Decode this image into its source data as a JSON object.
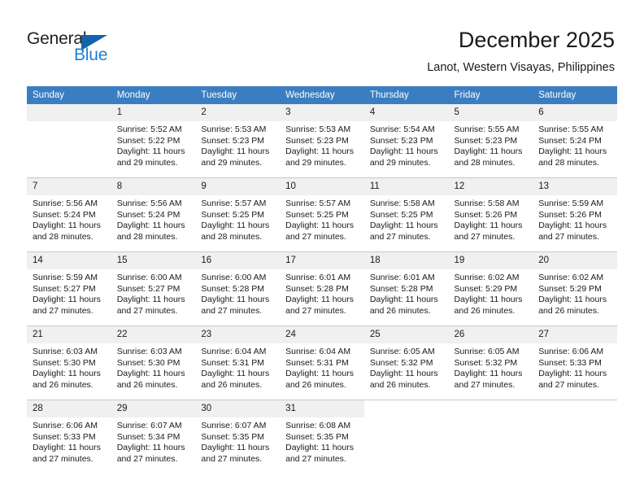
{
  "brand": {
    "name_top": "General",
    "name_bottom": "Blue",
    "accent_color": "#1c7fd4",
    "flag_color": "#1263ad",
    "logo_icon": "triangle-flag-icon"
  },
  "header": {
    "title": "December 2025",
    "subtitle": "Lanot, Western Visayas, Philippines"
  },
  "calendar": {
    "header_bg": "#3a7ec1",
    "daynum_bg": "#f0f0f0",
    "weekdays": [
      "Sunday",
      "Monday",
      "Tuesday",
      "Wednesday",
      "Thursday",
      "Friday",
      "Saturday"
    ],
    "weeks": [
      [
        {
          "day": "",
          "sunrise": "",
          "sunset": "",
          "daylight": "",
          "empty": true
        },
        {
          "day": "1",
          "sunrise": "Sunrise: 5:52 AM",
          "sunset": "Sunset: 5:22 PM",
          "daylight": "Daylight: 11 hours and 29 minutes."
        },
        {
          "day": "2",
          "sunrise": "Sunrise: 5:53 AM",
          "sunset": "Sunset: 5:23 PM",
          "daylight": "Daylight: 11 hours and 29 minutes."
        },
        {
          "day": "3",
          "sunrise": "Sunrise: 5:53 AM",
          "sunset": "Sunset: 5:23 PM",
          "daylight": "Daylight: 11 hours and 29 minutes."
        },
        {
          "day": "4",
          "sunrise": "Sunrise: 5:54 AM",
          "sunset": "Sunset: 5:23 PM",
          "daylight": "Daylight: 11 hours and 29 minutes."
        },
        {
          "day": "5",
          "sunrise": "Sunrise: 5:55 AM",
          "sunset": "Sunset: 5:23 PM",
          "daylight": "Daylight: 11 hours and 28 minutes."
        },
        {
          "day": "6",
          "sunrise": "Sunrise: 5:55 AM",
          "sunset": "Sunset: 5:24 PM",
          "daylight": "Daylight: 11 hours and 28 minutes."
        }
      ],
      [
        {
          "day": "7",
          "sunrise": "Sunrise: 5:56 AM",
          "sunset": "Sunset: 5:24 PM",
          "daylight": "Daylight: 11 hours and 28 minutes."
        },
        {
          "day": "8",
          "sunrise": "Sunrise: 5:56 AM",
          "sunset": "Sunset: 5:24 PM",
          "daylight": "Daylight: 11 hours and 28 minutes."
        },
        {
          "day": "9",
          "sunrise": "Sunrise: 5:57 AM",
          "sunset": "Sunset: 5:25 PM",
          "daylight": "Daylight: 11 hours and 28 minutes."
        },
        {
          "day": "10",
          "sunrise": "Sunrise: 5:57 AM",
          "sunset": "Sunset: 5:25 PM",
          "daylight": "Daylight: 11 hours and 27 minutes."
        },
        {
          "day": "11",
          "sunrise": "Sunrise: 5:58 AM",
          "sunset": "Sunset: 5:25 PM",
          "daylight": "Daylight: 11 hours and 27 minutes."
        },
        {
          "day": "12",
          "sunrise": "Sunrise: 5:58 AM",
          "sunset": "Sunset: 5:26 PM",
          "daylight": "Daylight: 11 hours and 27 minutes."
        },
        {
          "day": "13",
          "sunrise": "Sunrise: 5:59 AM",
          "sunset": "Sunset: 5:26 PM",
          "daylight": "Daylight: 11 hours and 27 minutes."
        }
      ],
      [
        {
          "day": "14",
          "sunrise": "Sunrise: 5:59 AM",
          "sunset": "Sunset: 5:27 PM",
          "daylight": "Daylight: 11 hours and 27 minutes."
        },
        {
          "day": "15",
          "sunrise": "Sunrise: 6:00 AM",
          "sunset": "Sunset: 5:27 PM",
          "daylight": "Daylight: 11 hours and 27 minutes."
        },
        {
          "day": "16",
          "sunrise": "Sunrise: 6:00 AM",
          "sunset": "Sunset: 5:28 PM",
          "daylight": "Daylight: 11 hours and 27 minutes."
        },
        {
          "day": "17",
          "sunrise": "Sunrise: 6:01 AM",
          "sunset": "Sunset: 5:28 PM",
          "daylight": "Daylight: 11 hours and 27 minutes."
        },
        {
          "day": "18",
          "sunrise": "Sunrise: 6:01 AM",
          "sunset": "Sunset: 5:28 PM",
          "daylight": "Daylight: 11 hours and 26 minutes."
        },
        {
          "day": "19",
          "sunrise": "Sunrise: 6:02 AM",
          "sunset": "Sunset: 5:29 PM",
          "daylight": "Daylight: 11 hours and 26 minutes."
        },
        {
          "day": "20",
          "sunrise": "Sunrise: 6:02 AM",
          "sunset": "Sunset: 5:29 PM",
          "daylight": "Daylight: 11 hours and 26 minutes."
        }
      ],
      [
        {
          "day": "21",
          "sunrise": "Sunrise: 6:03 AM",
          "sunset": "Sunset: 5:30 PM",
          "daylight": "Daylight: 11 hours and 26 minutes."
        },
        {
          "day": "22",
          "sunrise": "Sunrise: 6:03 AM",
          "sunset": "Sunset: 5:30 PM",
          "daylight": "Daylight: 11 hours and 26 minutes."
        },
        {
          "day": "23",
          "sunrise": "Sunrise: 6:04 AM",
          "sunset": "Sunset: 5:31 PM",
          "daylight": "Daylight: 11 hours and 26 minutes."
        },
        {
          "day": "24",
          "sunrise": "Sunrise: 6:04 AM",
          "sunset": "Sunset: 5:31 PM",
          "daylight": "Daylight: 11 hours and 26 minutes."
        },
        {
          "day": "25",
          "sunrise": "Sunrise: 6:05 AM",
          "sunset": "Sunset: 5:32 PM",
          "daylight": "Daylight: 11 hours and 26 minutes."
        },
        {
          "day": "26",
          "sunrise": "Sunrise: 6:05 AM",
          "sunset": "Sunset: 5:32 PM",
          "daylight": "Daylight: 11 hours and 27 minutes."
        },
        {
          "day": "27",
          "sunrise": "Sunrise: 6:06 AM",
          "sunset": "Sunset: 5:33 PM",
          "daylight": "Daylight: 11 hours and 27 minutes."
        }
      ],
      [
        {
          "day": "28",
          "sunrise": "Sunrise: 6:06 AM",
          "sunset": "Sunset: 5:33 PM",
          "daylight": "Daylight: 11 hours and 27 minutes."
        },
        {
          "day": "29",
          "sunrise": "Sunrise: 6:07 AM",
          "sunset": "Sunset: 5:34 PM",
          "daylight": "Daylight: 11 hours and 27 minutes."
        },
        {
          "day": "30",
          "sunrise": "Sunrise: 6:07 AM",
          "sunset": "Sunset: 5:35 PM",
          "daylight": "Daylight: 11 hours and 27 minutes."
        },
        {
          "day": "31",
          "sunrise": "Sunrise: 6:08 AM",
          "sunset": "Sunset: 5:35 PM",
          "daylight": "Daylight: 11 hours and 27 minutes."
        },
        {
          "day": "",
          "sunrise": "",
          "sunset": "",
          "daylight": "",
          "blank": true
        },
        {
          "day": "",
          "sunrise": "",
          "sunset": "",
          "daylight": "",
          "blank": true
        },
        {
          "day": "",
          "sunrise": "",
          "sunset": "",
          "daylight": "",
          "blank": true
        }
      ]
    ]
  }
}
